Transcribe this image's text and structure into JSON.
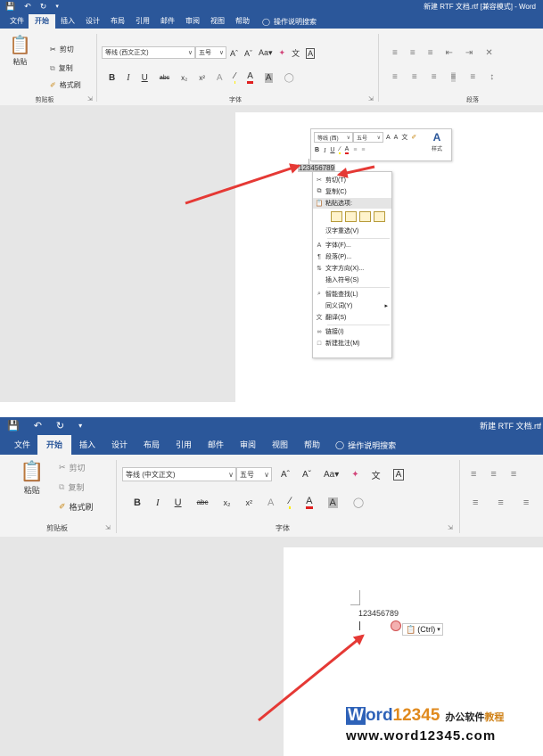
{
  "qat": {
    "save_icon": "save-icon",
    "undo_icon": "undo-icon",
    "redo_icon": "redo-icon",
    "customize_icon": "chevron-down-icon"
  },
  "panel1": {
    "title": "新建 RTF 文档.rtf [兼容模式] - Word",
    "tabs": [
      "文件",
      "开始",
      "插入",
      "设计",
      "布局",
      "引用",
      "邮件",
      "审阅",
      "视图",
      "帮助"
    ],
    "tell_me": "操作说明搜索",
    "clipboard": {
      "paste": "粘贴",
      "cut": "剪切",
      "copy": "复制",
      "format_painter": "格式刷",
      "group": "剪贴板"
    },
    "font": {
      "name": "等线 (西文正文)",
      "size": "五号",
      "group": "字体"
    },
    "paragraph": {
      "group": "段落"
    },
    "doc_text": "123456789",
    "minibar": {
      "font": "等线 (西)",
      "size": "五号",
      "styles": "样式"
    },
    "context_menu": [
      {
        "icon": "scissors-icon",
        "label": "剪切(T)"
      },
      {
        "icon": "copy-icon",
        "label": "复制(C)"
      },
      {
        "icon": "clipboard-icon",
        "label": "粘贴选项:",
        "highlight": true
      },
      {
        "icon": "",
        "label": ""
      },
      {
        "icon": "",
        "label": "汉字重选(V)"
      },
      {
        "icon": "font-icon",
        "label": "字体(F)..."
      },
      {
        "icon": "paragraph-icon",
        "label": "段落(P)..."
      },
      {
        "icon": "text-direction-icon",
        "label": "文字方向(X)..."
      },
      {
        "icon": "",
        "label": "插入符号(S)"
      },
      {
        "icon": "search-icon",
        "label": "智能查找(L)"
      },
      {
        "icon": "",
        "label": "同义词(Y)"
      },
      {
        "icon": "translate-icon",
        "label": "翻译(S)"
      },
      {
        "icon": "link-icon",
        "label": "链接(I)"
      },
      {
        "icon": "comment-icon",
        "label": "新建批注(M)"
      }
    ]
  },
  "panel2": {
    "title": "新建 RTF 文档.rtf",
    "tabs": [
      "文件",
      "开始",
      "插入",
      "设计",
      "布局",
      "引用",
      "邮件",
      "审阅",
      "视图",
      "帮助"
    ],
    "tell_me": "操作说明搜索",
    "clipboard": {
      "paste": "粘贴",
      "cut": "剪切",
      "copy": "复制",
      "format_painter": "格式刷",
      "group": "剪贴板"
    },
    "font": {
      "name": "等线 (中文正文)",
      "size": "五号",
      "group": "字体"
    },
    "doc_text": "123456789",
    "paste_ctrl": "(Ctrl)"
  },
  "watermark": {
    "w": "W",
    "ord": "ord",
    "num": "12345",
    "cn1": "办公软件",
    "cn2": "教程",
    "url": "www.word12345.com"
  },
  "colors": {
    "word_blue": "#2b579a",
    "arrow_red": "#e53935",
    "ribbon_bg": "#f3f3f3"
  }
}
